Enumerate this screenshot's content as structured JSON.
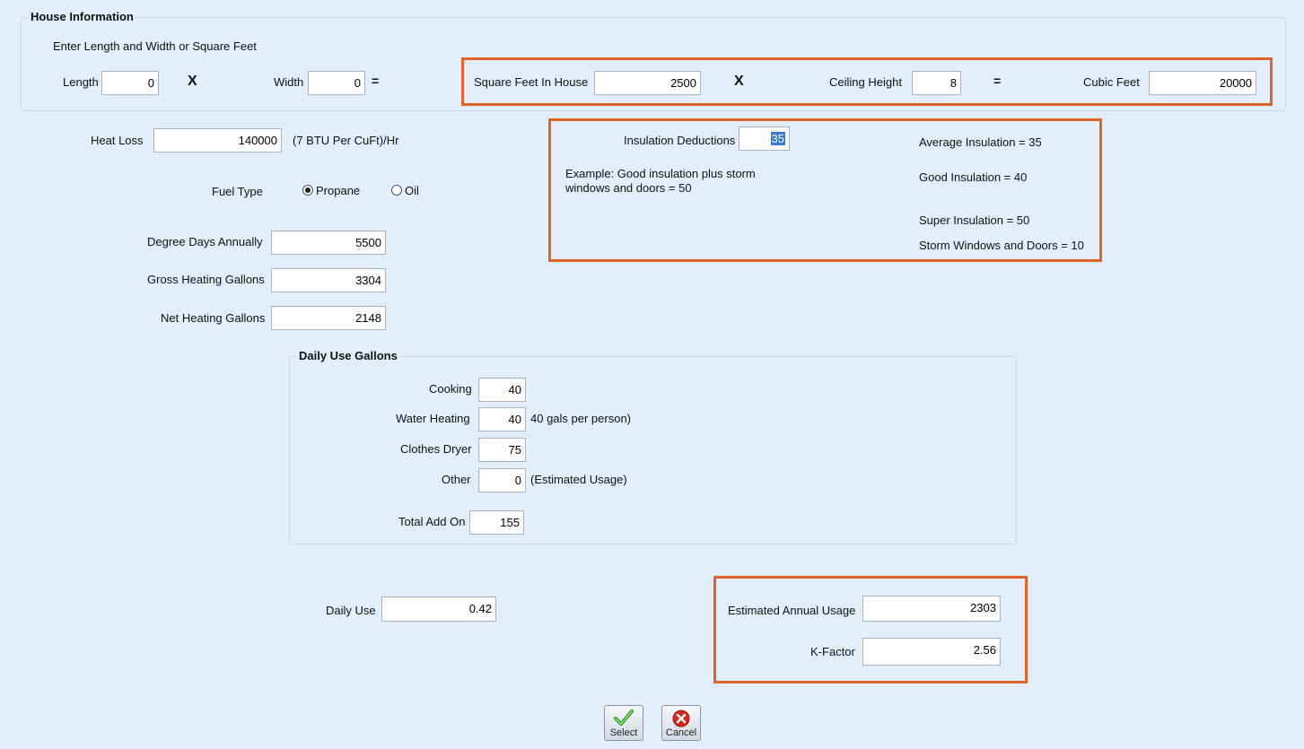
{
  "house_info": {
    "title": "House Information",
    "instruction": "Enter Length and Width or Square Feet",
    "length_label": "Length",
    "length_value": "0",
    "times1": "X",
    "width_label": "Width",
    "width_value": "0",
    "equals1": "=",
    "sqft_label": "Square Feet In House",
    "sqft_value": "2500",
    "times2": "X",
    "ceiling_label": "Ceiling Height",
    "ceiling_value": "8",
    "equals2": "=",
    "cubic_label": "Cubic Feet",
    "cubic_value": "20000"
  },
  "heat": {
    "heat_loss_label": "Heat Loss",
    "heat_loss_value": "140000",
    "heat_loss_note": "(7 BTU Per CuFt)/Hr",
    "fuel_type_label": "Fuel Type",
    "fuel_options": [
      {
        "label": "Propane",
        "selected": true
      },
      {
        "label": "Oil",
        "selected": false
      }
    ],
    "degree_days_label": "Degree Days Annually",
    "degree_days_value": "5500",
    "gross_label": "Gross Heating Gallons",
    "gross_value": "3304",
    "net_label": "Net Heating Gallons",
    "net_value": "2148"
  },
  "insulation": {
    "deductions_label": "Insulation Deductions",
    "deductions_value": "35",
    "example_line1": "Example:  Good insulation plus storm",
    "example_line2": "windows and doors = 50",
    "average": "Average Insulation = 35",
    "good": "Good Insulation = 40",
    "super": "Super Insulation = 50",
    "storm": "Storm Windows and Doors = 10"
  },
  "daily_use_gallons": {
    "title": "Daily Use Gallons",
    "cooking_label": "Cooking",
    "cooking_value": "40",
    "water_label": "Water Heating",
    "water_value": "40",
    "water_note": "40 gals per person)",
    "dryer_label": "Clothes Dryer",
    "dryer_value": "75",
    "other_label": "Other",
    "other_value": "0",
    "other_note": "(Estimated Usage)",
    "total_label": "Total Add On",
    "total_value": "155"
  },
  "results": {
    "daily_use_label": "Daily Use",
    "daily_use_value": "0.42",
    "annual_label": "Estimated Annual Usage",
    "annual_value": "2303",
    "kfactor_label": "K-Factor",
    "kfactor_value": "2.56"
  },
  "buttons": {
    "select_label": "Select",
    "cancel_label": "Cancel"
  },
  "colors": {
    "background": "#e2eefc",
    "highlight": "#e0642a"
  }
}
